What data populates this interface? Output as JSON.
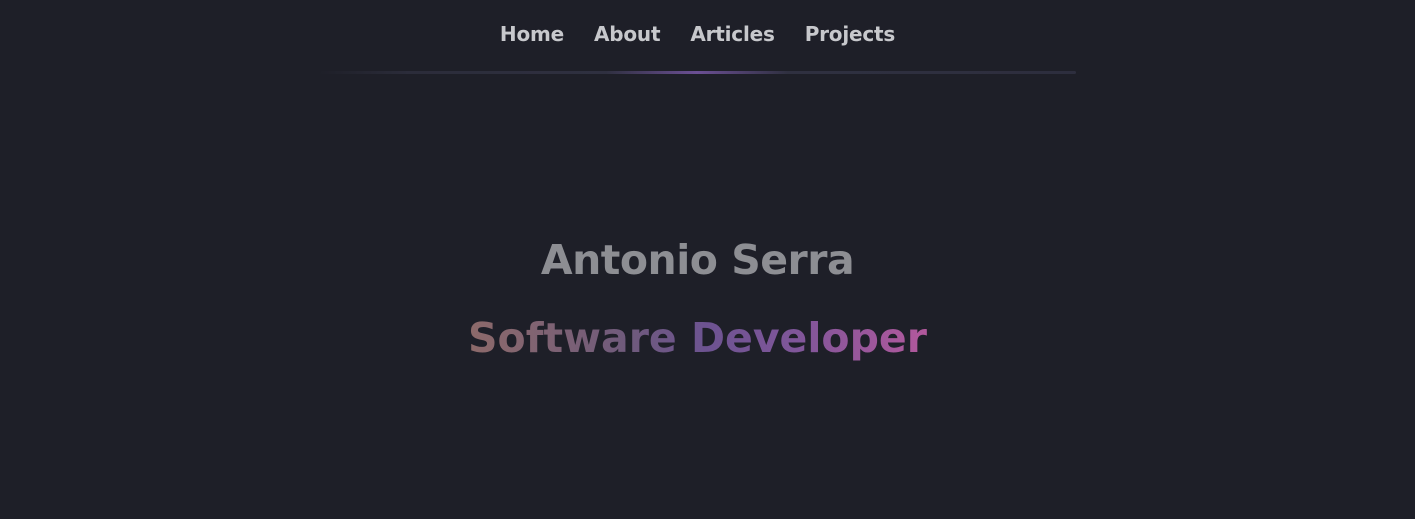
{
  "nav": {
    "items": [
      {
        "label": "Home"
      },
      {
        "label": "About"
      },
      {
        "label": "Articles"
      },
      {
        "label": "Projects"
      }
    ]
  },
  "hero": {
    "name": "Antonio Serra",
    "role": "Software Developer"
  },
  "colors": {
    "background": "#1e1f28",
    "nav_text": "#c7c8cc",
    "name_text": "#8d8e93",
    "accent_purple": "#6d5391",
    "accent_pink": "#b2589c"
  }
}
